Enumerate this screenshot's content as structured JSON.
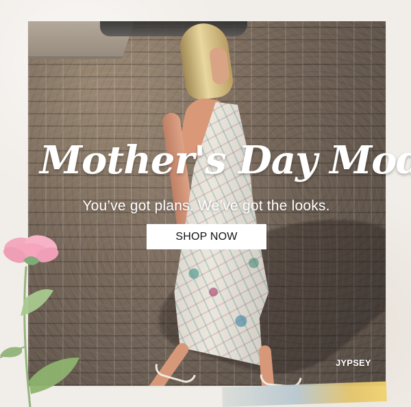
{
  "promo": {
    "headline": "Mother's Day Mode",
    "subheadline": "You’ve got plans. We’ve got the looks.",
    "button_label": "SHOP NOW",
    "brand": "JYPSEY"
  },
  "colors": {
    "background": "#f1ede8",
    "text": "#ffffff",
    "button": "#ffffff",
    "button_text": "#111111",
    "flower_pink": "#f2aabe",
    "leaf_green": "#93b57c"
  },
  "icons": {
    "decoration": "pink-flower-icon"
  }
}
